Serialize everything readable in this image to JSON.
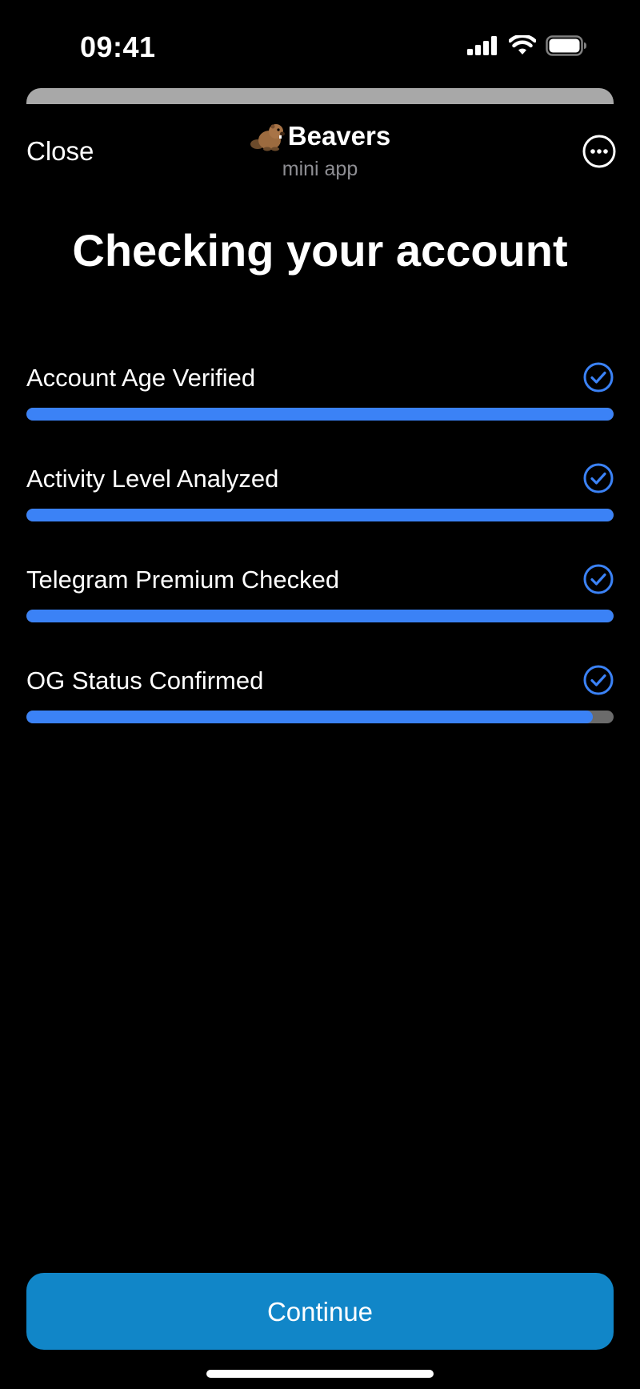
{
  "status_bar": {
    "time": "09:41",
    "icons": [
      "signal-icon",
      "wifi-icon",
      "battery-icon"
    ]
  },
  "header": {
    "close_label": "Close",
    "app_name": "Beavers",
    "app_subtitle": "mini app",
    "logo_icon": "beaver-emoji-icon",
    "more_icon": "more-horizontal-icon"
  },
  "page": {
    "title": "Checking your account"
  },
  "checks": [
    {
      "label": "Account Age Verified",
      "progress": 1.0,
      "status": "checked"
    },
    {
      "label": "Activity Level Analyzed",
      "progress": 1.0,
      "status": "checked"
    },
    {
      "label": "Telegram Premium Checked",
      "progress": 1.0,
      "status": "checked"
    },
    {
      "label": "OG Status Confirmed",
      "progress": 0.965,
      "status": "checked"
    }
  ],
  "footer": {
    "continue_label": "Continue"
  },
  "colors": {
    "background": "#000000",
    "accent_blue": "#3b82f6",
    "button_blue": "#1186c8",
    "track_gray": "#6b6b6b",
    "subtitle_gray": "#8e8e93"
  }
}
